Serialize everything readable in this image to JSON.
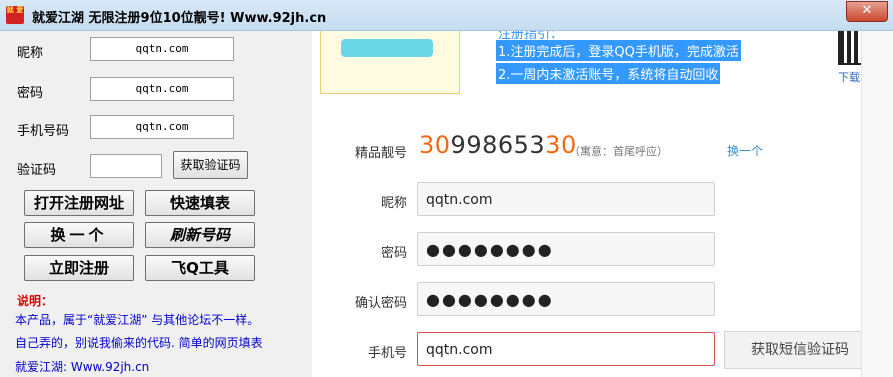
{
  "window": {
    "title": "就爱江湖 无限注册9位10位靓号! Www.92jh.cn",
    "icon_text": "就\n爱",
    "close_label": "✕"
  },
  "left_panel": {
    "nickname_label": "昵称",
    "nickname_value": "qqtn.com",
    "password_label": "密码",
    "password_value": "qqtn.com",
    "phone_label": "手机号码",
    "phone_value": "qqtn.com",
    "captcha_label": "验证码",
    "captcha_value": "",
    "get_captcha_button": "获取验证码",
    "open_url_button": "打开注册网址",
    "quick_fill_button": "快速填表",
    "change_one_button": "换一个",
    "refresh_number_button": "刷新号码",
    "register_now_button": "立即注册",
    "fly_q_tool_button": "飞Q工具",
    "note_title": "说明：",
    "notes": [
      "本产品，属于“就爱江湖” 与其他论坛不一样。",
      "自己弄的，别说我偷来的代码. 简单的网页填表",
      "就爱江湖: Www.92jh.cn"
    ]
  },
  "web_panel": {
    "guide_partial": "注册指引：",
    "guide_lines": [
      "1.注册完成后，登录QQ手机版，完成激活",
      "2.一周内未激活账号，系统将自动回收"
    ],
    "download_label": "下载",
    "number_label": "精品靓号",
    "number_prefix": "30",
    "number_middle": "998653",
    "number_suffix": "30",
    "number_meaning": "（寓意：首尾呼应）",
    "change_link": "换一个",
    "nickname_label": "昵称",
    "nickname_value": "qqtn.com",
    "password_label": "密码",
    "password_value": "●●●●●●●●",
    "confirm_label": "确认密码",
    "confirm_value": "●●●●●●●●",
    "phone_label": "手机号",
    "phone_value": "qqtn.com",
    "sms_button": "获取短信验证码"
  }
}
